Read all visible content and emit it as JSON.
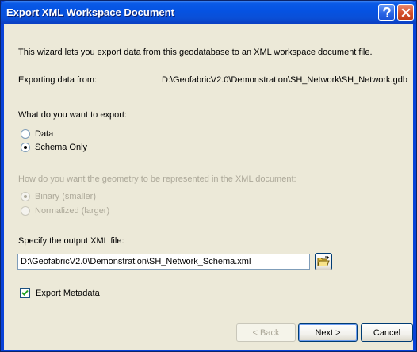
{
  "window": {
    "title": "Export XML Workspace Document"
  },
  "intro": "This wizard lets you export data from this geodatabase to an XML workspace document file.",
  "source": {
    "label": "Exporting data from:",
    "path": "D:\\GeofabricV2.0\\Demonstration\\SH_Network\\SH_Network.gdb"
  },
  "export_what": {
    "question": "What do you want to export:",
    "options": [
      {
        "label": "Data",
        "selected": false
      },
      {
        "label": "Schema Only",
        "selected": true
      }
    ]
  },
  "geometry": {
    "question": "How do you want the geometry to be represented in the XML document:",
    "enabled": false,
    "options": [
      {
        "label": "Binary (smaller)",
        "selected": true
      },
      {
        "label": "Normalized (larger)",
        "selected": false
      }
    ]
  },
  "output": {
    "label": "Specify the output XML file:",
    "value": "D:\\GeofabricV2.0\\Demonstration\\SH_Network_Schema.xml",
    "browse_icon": "open-folder-icon"
  },
  "metadata": {
    "label": "Export Metadata",
    "checked": true
  },
  "buttons": {
    "back": "< Back",
    "next": "Next >",
    "cancel": "Cancel"
  },
  "colors": {
    "titlebar": "#0553e3",
    "dialog_bg": "#ece9d8",
    "disabled_text": "#aca899",
    "close_button": "#d6532f"
  }
}
